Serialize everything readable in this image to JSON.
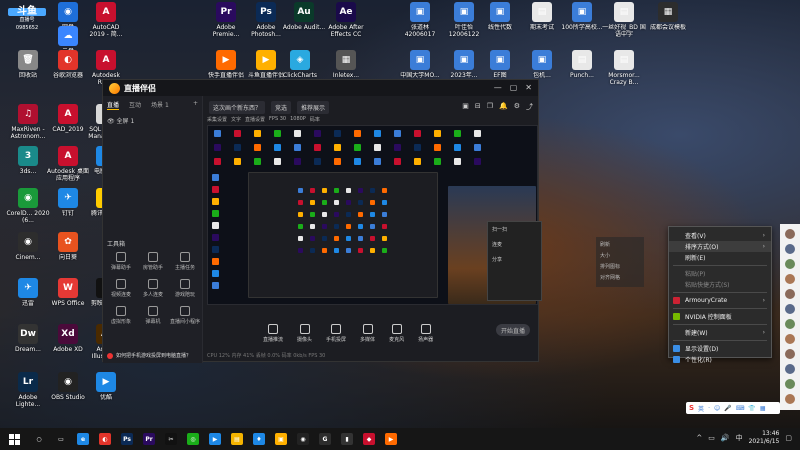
{
  "watermark": {
    "brand": "斗鱼",
    "sub1": "直播号",
    "sub2": "0985652"
  },
  "desktop_icons": [
    {
      "label": "网盘",
      "color": "#1e6fd9",
      "glyph": "◉"
    },
    {
      "label": "云盘",
      "color": "#3a86ff",
      "glyph": "☁"
    },
    {
      "label": "AutoCAD 2019 - 简...",
      "color": "#c8102e",
      "glyph": "A"
    },
    {
      "label": "Adobe Premie...",
      "color": "#2a0a5e",
      "glyph": "Pr"
    },
    {
      "label": "Adobe Photosh...",
      "color": "#0b2a55",
      "glyph": "Ps"
    },
    {
      "label": "Adobe Audit...",
      "color": "#0a3a2a",
      "glyph": "Au"
    },
    {
      "label": "Adobe After Effects CC",
      "color": "#1a0a4a",
      "glyph": "Ae"
    },
    {
      "label": "张道林 42006017",
      "color": "#3b7dd8",
      "glyph": "▣"
    },
    {
      "label": "叶佳怡 12006122",
      "color": "#3b7dd8",
      "glyph": "▣"
    },
    {
      "label": "线性代数",
      "color": "#3b7dd8",
      "glyph": "▣"
    },
    {
      "label": "期末考试",
      "color": "#e8e8e8",
      "glyph": "▤"
    },
    {
      "label": "100所学高校...",
      "color": "#3b7dd8",
      "glyph": "▣"
    },
    {
      "label": "一丝好视_BD 国语中字",
      "color": "#e8e8e8",
      "glyph": "▤"
    },
    {
      "label": "成都会议模板",
      "color": "#2d2d2d",
      "glyph": "▦"
    },
    {
      "label": "回收站",
      "color": "#888888",
      "glyph": "🗑"
    },
    {
      "label": "谷歌浏览器",
      "color": "#e2342a",
      "glyph": "◐"
    },
    {
      "label": "Autodesk Rec...",
      "color": "#c8102e",
      "glyph": "A"
    },
    {
      "label": "快手直播伴侣",
      "color": "#ff6a00",
      "glyph": "▶"
    },
    {
      "label": "斗鱼直播伴侣",
      "color": "#ffb000",
      "glyph": "▶"
    },
    {
      "label": "ClickCharts",
      "color": "#2aa9e0",
      "glyph": "◈"
    },
    {
      "label": "Inletex...",
      "color": "#555555",
      "glyph": "▦"
    },
    {
      "label": "中国大学MO...",
      "color": "#3b7dd8",
      "glyph": "▣"
    },
    {
      "label": "2023年...",
      "color": "#3b7dd8",
      "glyph": "▣"
    },
    {
      "label": "EF图",
      "color": "#3b7dd8",
      "glyph": "▣"
    },
    {
      "label": "包机...",
      "color": "#3b7dd8",
      "glyph": "▣"
    },
    {
      "label": "Punch...",
      "color": "#e8e8e8",
      "glyph": "▤"
    },
    {
      "label": "Morsmor... Crazy B...",
      "color": "#e8e8e8",
      "glyph": "▤"
    },
    {
      "label": "MaxRiven - Astronom...",
      "color": "#b01030",
      "glyph": "♫"
    },
    {
      "label": "CAD_2019",
      "color": "#c8102e",
      "glyph": "A"
    },
    {
      "label": "SQL Server Managem...",
      "color": "#d8d8d8",
      "glyph": "S"
    },
    {
      "label": "3ds...",
      "color": "#1a8a8a",
      "glyph": "3"
    },
    {
      "label": "Autodesk 桌面应用程序",
      "color": "#c8102e",
      "glyph": "A"
    },
    {
      "label": "电脑管家",
      "color": "#1e88e5",
      "glyph": "◆"
    },
    {
      "label": "CorelD... 2020 (6...",
      "color": "#1a9a3a",
      "glyph": "◉"
    },
    {
      "label": "钉钉",
      "color": "#1e88e5",
      "glyph": "✈"
    },
    {
      "label": "腾讯影视库",
      "color": "#ffcc00",
      "glyph": "▣"
    },
    {
      "label": "Cinem...",
      "color": "#2d2d2d",
      "glyph": "◉"
    },
    {
      "label": "向日葵",
      "color": "#e8531f",
      "glyph": "✿"
    },
    {
      "label": "迅雷",
      "color": "#1e88e5",
      "glyph": "✈"
    },
    {
      "label": "WPS Office",
      "color": "#e53935",
      "glyph": "W"
    },
    {
      "label": "剪映专业版",
      "color": "#111111",
      "glyph": "✂"
    },
    {
      "label": "Dream...",
      "color": "#333333",
      "glyph": "Dw"
    },
    {
      "label": "Adobe XD",
      "color": "#4a0a3a",
      "glyph": "Xd"
    },
    {
      "label": "Adobe Illustrat...",
      "color": "#4a2a00",
      "glyph": "Ai"
    },
    {
      "label": "Adobe Lighte...",
      "color": "#0a2a4a",
      "glyph": "Lr"
    },
    {
      "label": "OBS Studio",
      "color": "#222222",
      "glyph": "◉"
    },
    {
      "label": "优酷",
      "color": "#1e88e5",
      "glyph": "▶"
    },
    {
      "label": "微软影视",
      "color": "#1e88e5",
      "glyph": "▲"
    }
  ],
  "app": {
    "name": "直播伴侣",
    "left_tabs": [
      "直播",
      "互动",
      "场景 1"
    ],
    "scene_item": "全屏 1",
    "tools_title": "工具箱",
    "tools": [
      "弹幕助手",
      "房管助手",
      "主播任务",
      "视频连麦",
      "多人连麦",
      "游戏陪玩",
      "虚拟形象",
      "弹幕机",
      "直播间小程序"
    ],
    "left_tip": "如何把手机游戏投屏到电脑直播？",
    "top_tabs": [
      "这次画个新东西？",
      "竞选",
      "推荐展示"
    ],
    "sub_bar": [
      "采集设置",
      "文字",
      "直播设置",
      "FPS 30",
      "1080P",
      "码率"
    ],
    "toolbar": [
      {
        "label": "直播推流"
      },
      {
        "label": "摄像头"
      },
      {
        "label": "手机投屏"
      },
      {
        "label": "多媒体"
      },
      {
        "label": "麦克风"
      },
      {
        "label": "扬声器"
      }
    ],
    "live_button": "开始直播",
    "status": "CPU 12%  内存 41%  丢帧 0.0%  码率 0kb/s  FPS 30"
  },
  "float_win": {
    "items": [
      "扫一扫",
      "连麦",
      "分享"
    ]
  },
  "submenu": [
    "刷新",
    "大小",
    "排列图标",
    "对齐网格"
  ],
  "context_menu": [
    {
      "label": "查看(V)",
      "arrow": true,
      "disabled": false,
      "hover": false
    },
    {
      "label": "排序方式(O)",
      "arrow": true,
      "disabled": false,
      "hover": true
    },
    {
      "label": "刷新(E)",
      "arrow": false,
      "disabled": false,
      "hover": false
    },
    {
      "sep": true
    },
    {
      "label": "粘贴(P)",
      "arrow": false,
      "disabled": true,
      "hover": false
    },
    {
      "label": "粘贴快捷方式(S)",
      "arrow": false,
      "disabled": true,
      "hover": false
    },
    {
      "sep": true
    },
    {
      "label": "ArmouryCrate",
      "arrow": true,
      "disabled": false,
      "hover": false,
      "icon_color": "#cc2233"
    },
    {
      "sep": true
    },
    {
      "label": "NVIDIA 控制面板",
      "arrow": false,
      "disabled": false,
      "hover": false,
      "icon_color": "#76b900"
    },
    {
      "sep": true
    },
    {
      "label": "新建(W)",
      "arrow": true,
      "disabled": false,
      "hover": false
    },
    {
      "sep": true
    },
    {
      "label": "显示设置(D)",
      "arrow": false,
      "disabled": false,
      "hover": false,
      "icon_color": "#3a8ee6"
    },
    {
      "label": "个性化(R)",
      "arrow": false,
      "disabled": false,
      "hover": false,
      "icon_color": "#3a8ee6"
    }
  ],
  "ime": {
    "label": "S",
    "items": [
      "英",
      "·",
      "☺",
      "🎤",
      "⌨",
      "👕",
      "▦"
    ]
  },
  "taskbar": {
    "apps": [
      {
        "name": "search",
        "glyph": "○",
        "color": "#161616"
      },
      {
        "name": "task-view",
        "glyph": "▭",
        "color": "#161616"
      },
      {
        "name": "edge",
        "glyph": "e",
        "color": "#1e88e5"
      },
      {
        "name": "chrome",
        "glyph": "◐",
        "color": "#e2342a"
      },
      {
        "name": "photoshop",
        "glyph": "Ps",
        "color": "#0b2a55"
      },
      {
        "name": "premiere",
        "glyph": "Pr",
        "color": "#2a0a5e"
      },
      {
        "name": "capcut",
        "glyph": "✂",
        "color": "#111"
      },
      {
        "name": "wechat",
        "glyph": "◎",
        "color": "#1aad19"
      },
      {
        "name": "video",
        "glyph": "▶",
        "color": "#1e88e5"
      },
      {
        "name": "folder",
        "glyph": "▤",
        "color": "#f5b400"
      },
      {
        "name": "app-1",
        "glyph": "♦",
        "color": "#1e88e5"
      },
      {
        "name": "app-2",
        "glyph": "▣",
        "color": "#ffb000"
      },
      {
        "name": "app-3",
        "glyph": "◉",
        "color": "#222"
      },
      {
        "name": "app-4",
        "glyph": "G",
        "color": "#2d2d2d"
      },
      {
        "name": "app-5",
        "glyph": "▮",
        "color": "#333"
      },
      {
        "name": "app-6",
        "glyph": "◆",
        "color": "#c8102e"
      },
      {
        "name": "app-7",
        "glyph": "▶",
        "color": "#ff6a00"
      }
    ],
    "time": "13:46",
    "date": "2021/6/15",
    "ime_text": "中"
  }
}
